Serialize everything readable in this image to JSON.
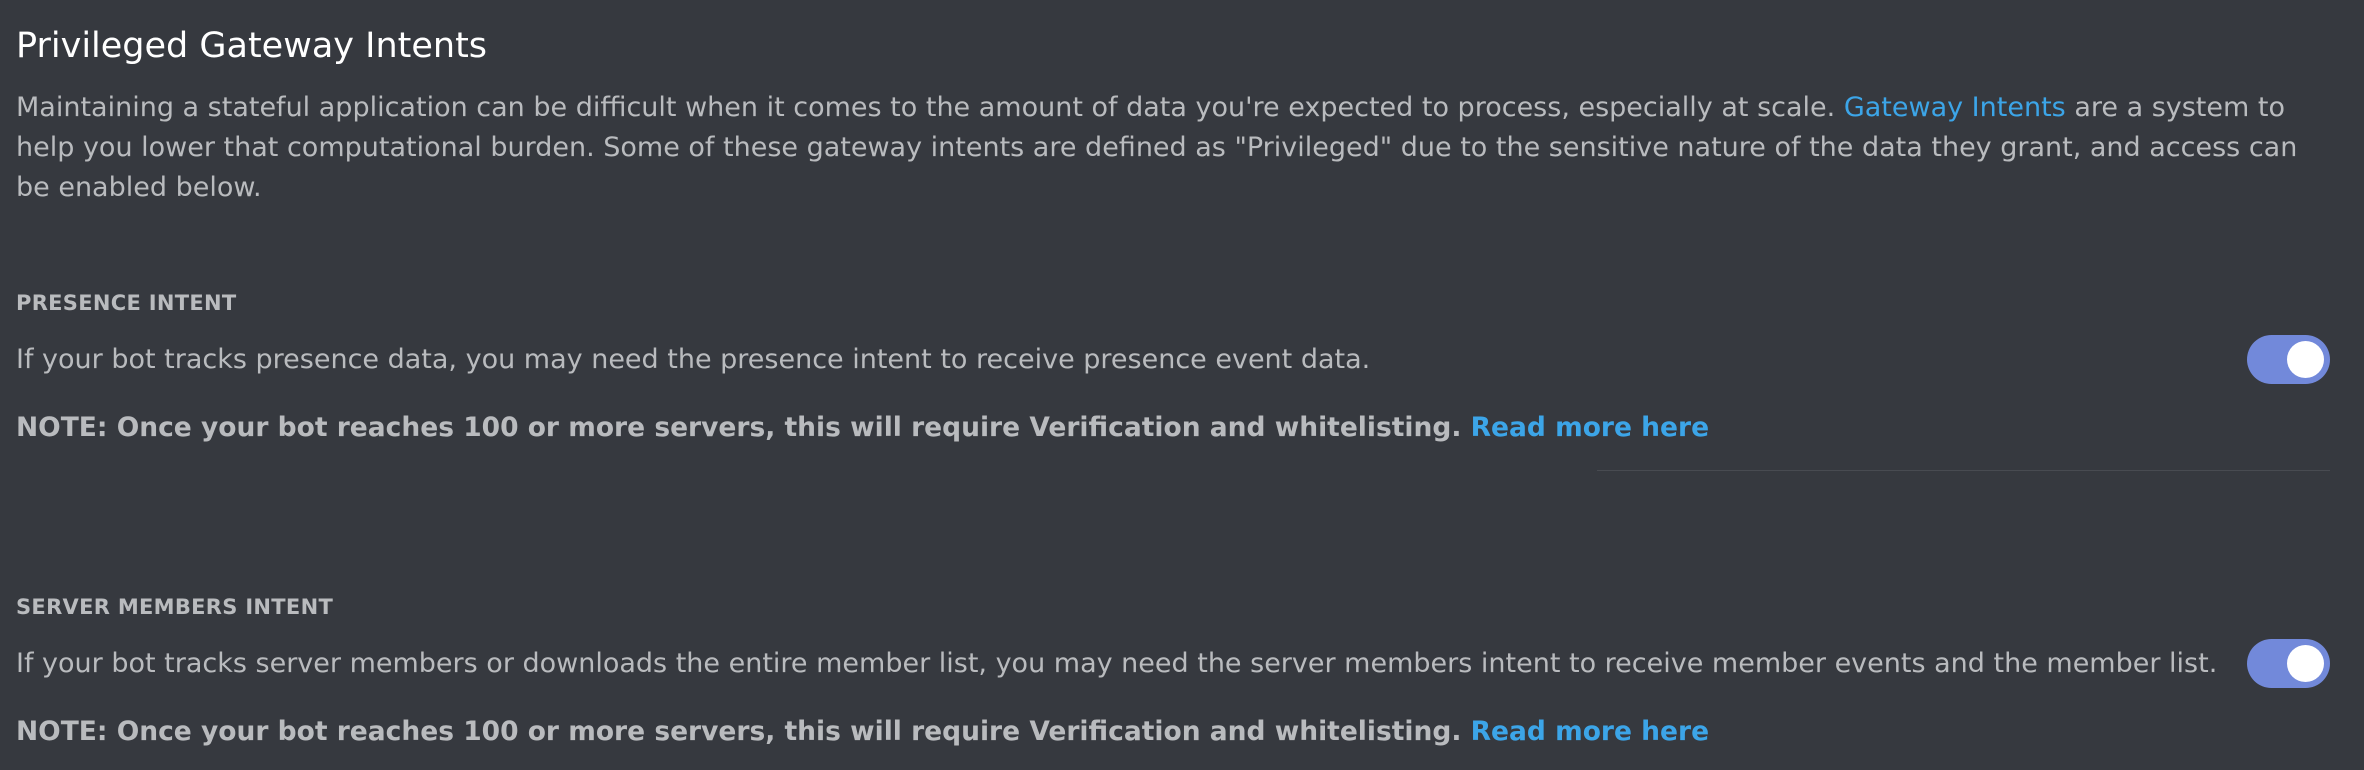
{
  "header": {
    "title": "Privileged Gateway Intents"
  },
  "intro": {
    "text_before": "Maintaining a stateful application can be difficult when it comes to the amount of data you're expected to process, especially at scale. ",
    "link": "Gateway Intents",
    "text_after": " are a system to help you lower that computational burden. Some of these gateway intents are defined as \"Privileged\" due to the sensitive nature of the data they grant, and access can be enabled below."
  },
  "intents": [
    {
      "label": "PRESENCE INTENT",
      "description": "If your bot tracks presence data, you may need the presence intent to receive presence event data.",
      "note": "NOTE: Once your bot reaches 100 or more servers, this will require Verification and whitelisting.",
      "link": "Read more here",
      "enabled": true
    },
    {
      "label": "SERVER MEMBERS INTENT",
      "description": "If your bot tracks server members or downloads the entire member list, you may need the server members intent to receive member events and the member list.",
      "note": "NOTE: Once your bot reaches 100 or more servers, this will require Verification and whitelisting.",
      "link": "Read more here",
      "enabled": true
    }
  ],
  "colors": {
    "background": "#36393f",
    "text": "#b9bbbe",
    "heading": "#ffffff",
    "link": "#3ca5e8",
    "toggle_on": "#7289da"
  }
}
